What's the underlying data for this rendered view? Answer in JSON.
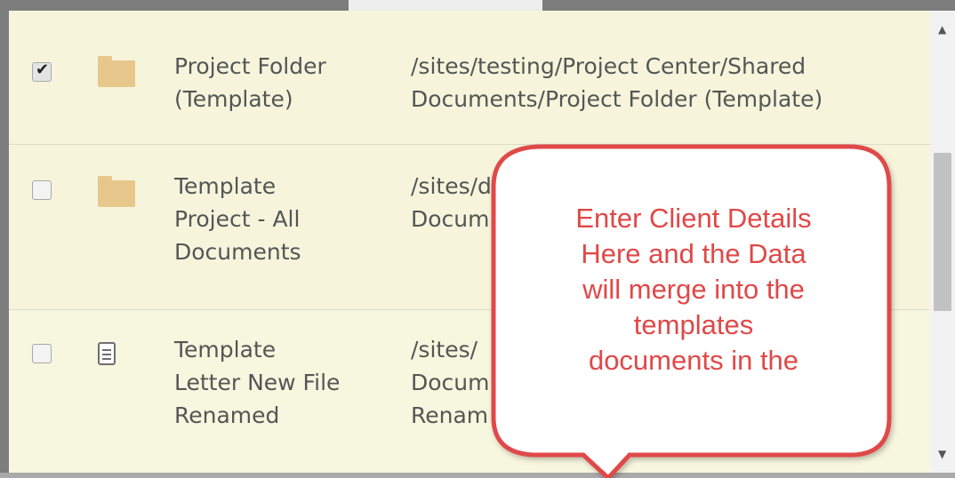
{
  "rows": [
    {
      "name": "Project Folder\n(Template)",
      "path": "/sites/testing/Project Center/Shared\nDocuments/Project Folder (Template)",
      "checked": true,
      "icon": "folder-icon"
    },
    {
      "name": "Template\nProject - All\nDocuments",
      "path": "/sites/d\nDocum",
      "checked": false,
      "icon": "folder-icon"
    },
    {
      "name": "Template\nLetter New File\nRenamed",
      "path": "/sites/\nDocum\nRenam",
      "checked": false,
      "icon": "document-icon"
    }
  ],
  "callout": {
    "text": "Enter Client Details\nHere and the Data\nwill merge into the\ntemplates\ndocuments in the",
    "border_color": "#e04848",
    "text_color": "#e04848"
  },
  "colors": {
    "row_background": "#f6f5dc",
    "folder": "#e8c78c"
  }
}
